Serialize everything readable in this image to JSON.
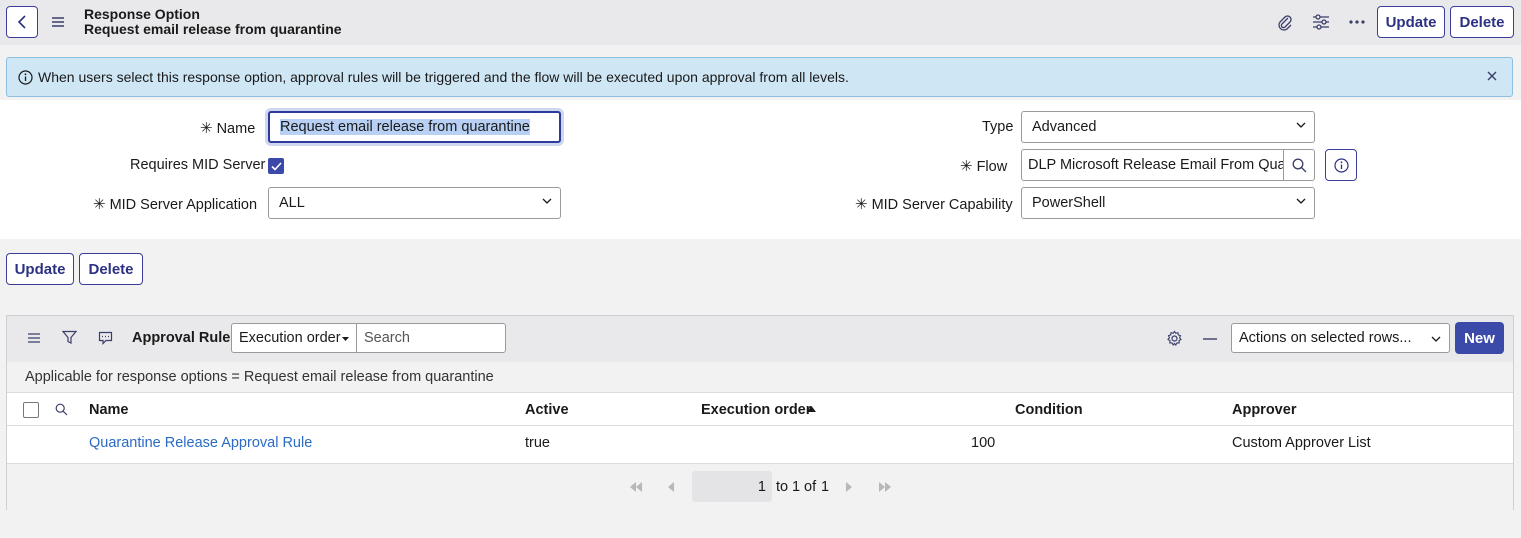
{
  "header": {
    "title": "Response Option",
    "subtitle": "Request email release from quarantine",
    "update_label": "Update",
    "delete_label": "Delete"
  },
  "banner": {
    "text": "When users select this response option, approval rules will be triggered and the flow will be executed upon approval from all levels."
  },
  "form": {
    "name_label": "Name",
    "name_value": "Request email release from quarantine",
    "requires_mid_label": "Requires MID Server",
    "requires_mid_checked": true,
    "mid_app_label": "MID Server Application",
    "mid_app_value": "ALL",
    "type_label": "Type",
    "type_value": "Advanced",
    "flow_label": "Flow",
    "flow_value": "DLP Microsoft Release Email From Quar:",
    "mid_cap_label": "MID Server Capability",
    "mid_cap_value": "PowerShell"
  },
  "form_actions": {
    "update_label": "Update",
    "delete_label": "Delete"
  },
  "related_list": {
    "title": "Approval Rules",
    "sort_select": "Execution order",
    "search_placeholder": "Search",
    "actions_select": "Actions on selected rows...",
    "new_label": "New",
    "filter_text": "Applicable for response options = Request email release from quarantine",
    "columns": [
      "Name",
      "Active",
      "Execution order",
      "Condition",
      "Approver"
    ],
    "rows": [
      {
        "name": "Quarantine Release Approval Rule",
        "active": "true",
        "execution_order": "100",
        "condition": "",
        "approver": "Custom Approver List"
      }
    ],
    "pager": {
      "current": "1",
      "to_text": "to",
      "end": "1",
      "of_text": "of",
      "total": "1"
    }
  },
  "colors": {
    "accent": "#2c3183",
    "link": "#2a6bc4",
    "banner_bg": "#cfe6f5"
  }
}
